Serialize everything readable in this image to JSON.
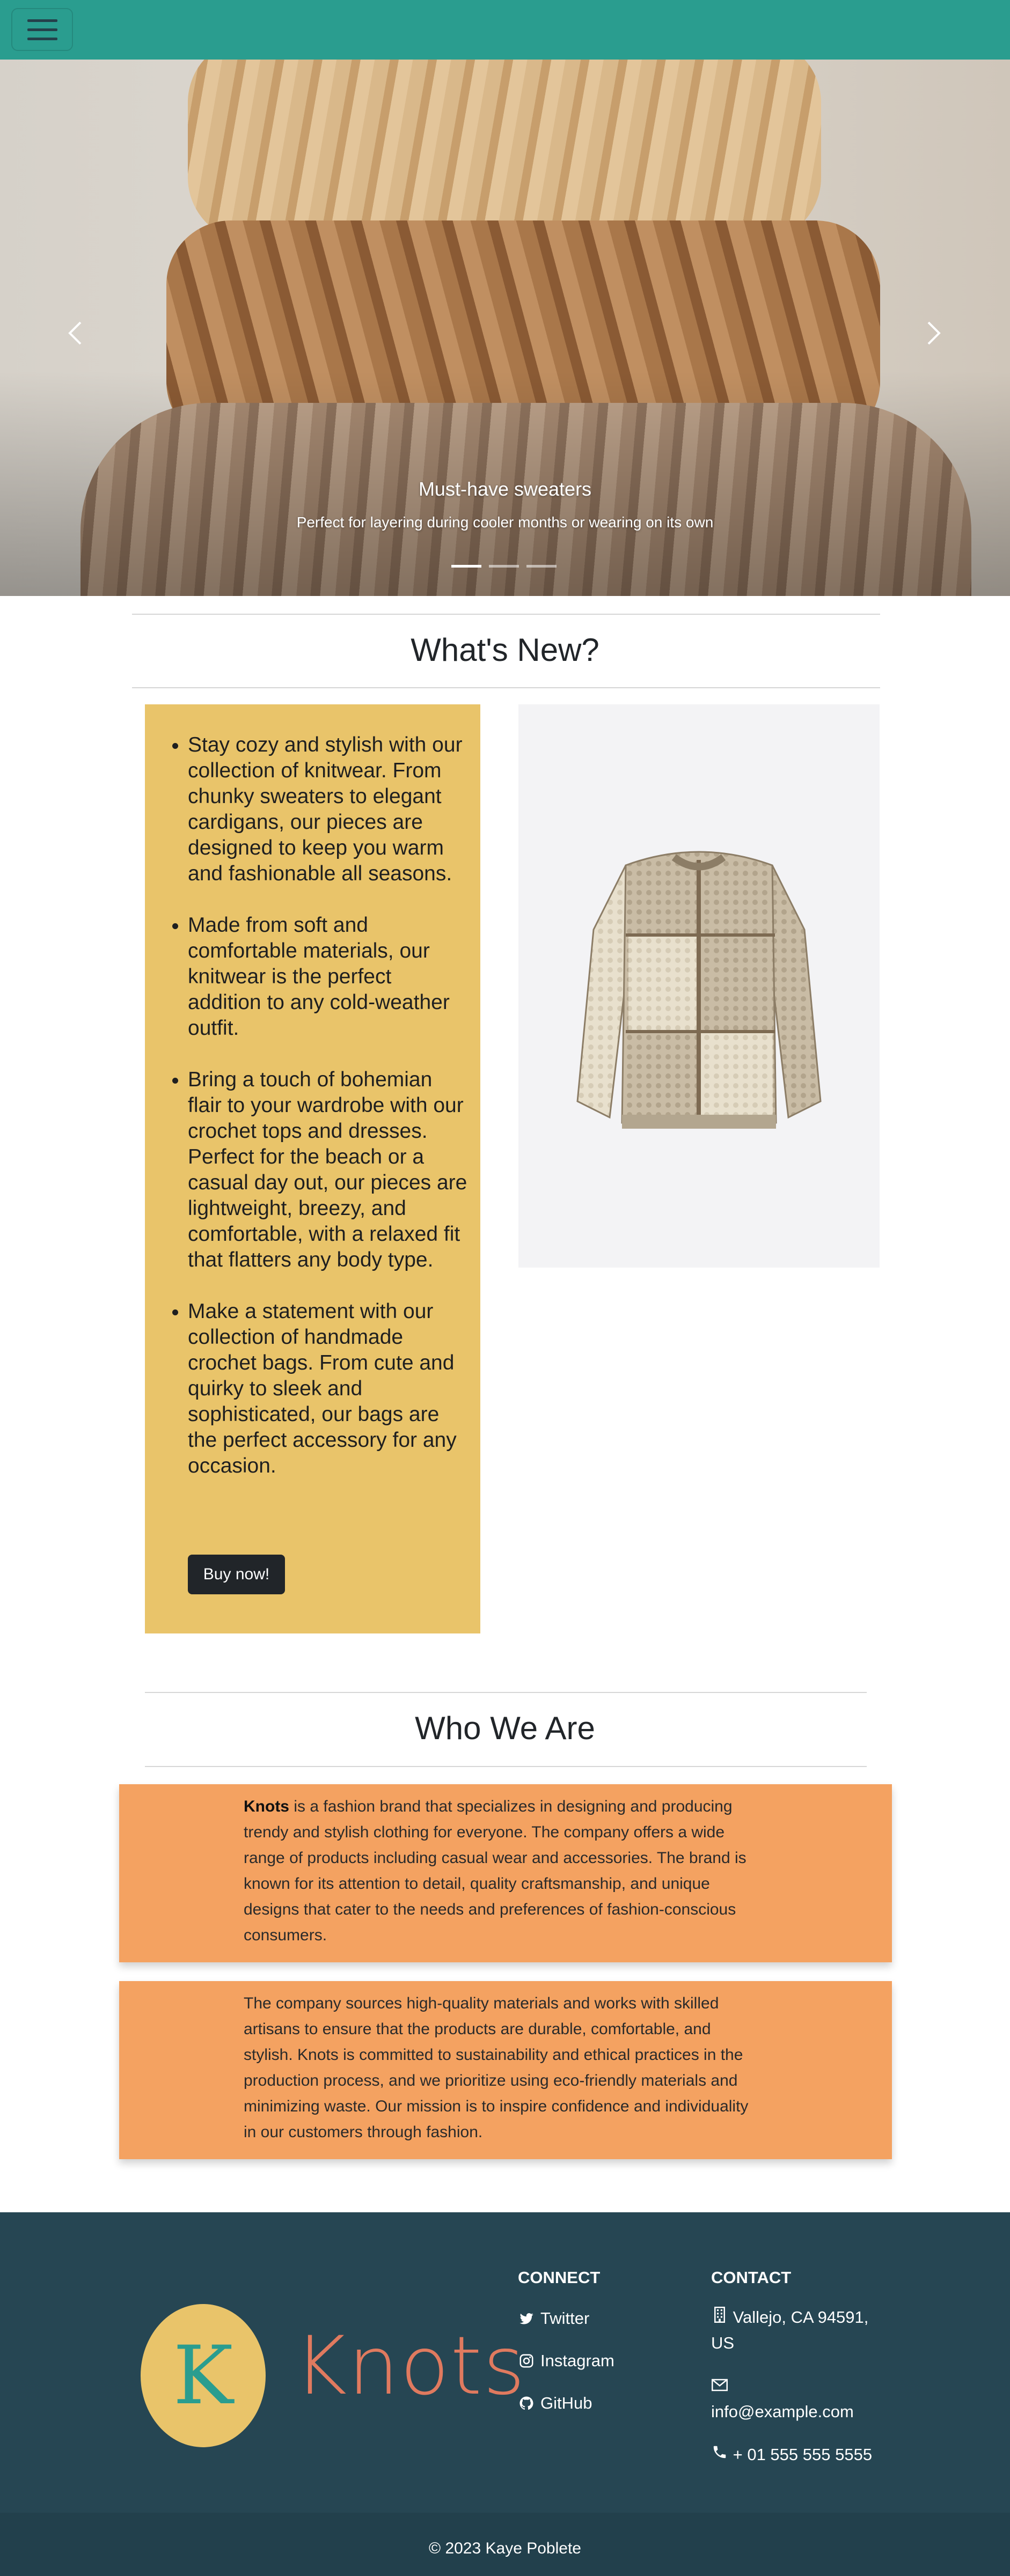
{
  "navbar": {
    "toggler_label": "Toggle navigation"
  },
  "carousel": {
    "slides": [
      {
        "title": "Must-have sweaters",
        "caption": "Perfect for layering during cooler months or wearing on its own"
      }
    ],
    "active_index": 0,
    "slide_count": 3
  },
  "whats_new": {
    "title": "What's New?",
    "items": [
      "Stay cozy and stylish with our collection of knitwear. From chunky sweaters to elegant cardigans, our pieces are designed to keep you warm and fashionable all seasons.",
      "Made from soft and comfortable materials, our knitwear is the perfect addition to any cold-weather outfit.",
      "Bring a touch of bohemian flair to your wardrobe with our crochet tops and dresses. Perfect for the beach or a casual day out, our pieces are lightweight, breezy, and comfortable, with a relaxed fit that flatters any body type.",
      "Make a statement with our collection of handmade crochet bags. From cute and quirky to sleek and sophisticated, our bags are the perfect accessory for any occasion."
    ],
    "button_label": "Buy now!"
  },
  "who_we_are": {
    "title": "Who We Are",
    "brand": "Knots",
    "paragraph1_rest": " is a fashion brand that specializes in designing and producing trendy and stylish clothing for everyone. The company offers a wide range of products including casual wear and accessories. The brand is known for its attention to detail, quality craftsmanship, and unique designs that cater to the needs and preferences of fashion-conscious consumers.",
    "paragraph2": "The company sources high-quality materials and works with skilled artisans to ensure that the products are durable, comfortable, and stylish. Knots is committed to sustainability and ethical practices in the production process, and we prioritize using eco-friendly materials and minimizing waste. Our mission is to inspire confidence and individuality in our customers through fashion."
  },
  "footer": {
    "logo_letter": "K",
    "logo_text": "Knots",
    "connect": {
      "heading": "CONNECT",
      "links": [
        {
          "label": "Twitter",
          "icon": "twitter-icon"
        },
        {
          "label": "Instagram",
          "icon": "instagram-icon"
        },
        {
          "label": "GitHub",
          "icon": "github-icon"
        }
      ]
    },
    "contact": {
      "heading": "CONTACT",
      "address_line1": "Vallejo, CA 94591,",
      "address_line2": "US",
      "email": "info@example.com",
      "phone": "+ 01 555 555 5555"
    },
    "copyright": "© 2023 Kaye Poblete"
  },
  "colors": {
    "navbar": "#2a9d8f",
    "yellow": "#e9c46a",
    "orange": "#f4a261",
    "footer": "#264653",
    "logo_text": "#e07a5f"
  }
}
